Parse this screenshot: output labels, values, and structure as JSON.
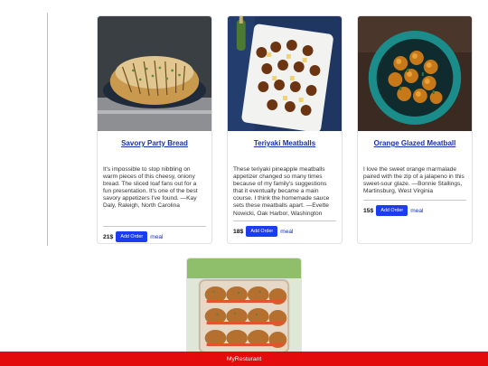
{
  "cards": [
    {
      "title": "Savory Party Bread",
      "description": "It's impossible to stop nibbling on warm pieces of this cheesy, oniony bread. The sliced loaf fans out for a fun presentation. It's one of the best savory appetizers I've found. —Kay Daly, Raleigh, North Carolina",
      "price": "21$",
      "button_label": "Add Order",
      "category": "meal"
    },
    {
      "title": "Teriyaki Meatballs",
      "description": "These teriyaki pineapple meatballs appetizer changed so many times because of my family's suggestions that it eventually became a main course. I think the homemade sauce sets these meatballs apart. —Evette Nowicki, Oak Harbor, Washington",
      "price": "18$",
      "button_label": "Add Order",
      "category": "meal"
    },
    {
      "title": "Orange Glazed Meatball",
      "description": "I love the sweet orange marmalade paired with the zip of a jalapeno in this sweet-sour glaze. —Bonnie Stallings, Martinsburg, West Virginia",
      "price": "15$",
      "button_label": "Add Order",
      "category": "meal"
    }
  ],
  "footer": {
    "brand": "MyResturant"
  }
}
